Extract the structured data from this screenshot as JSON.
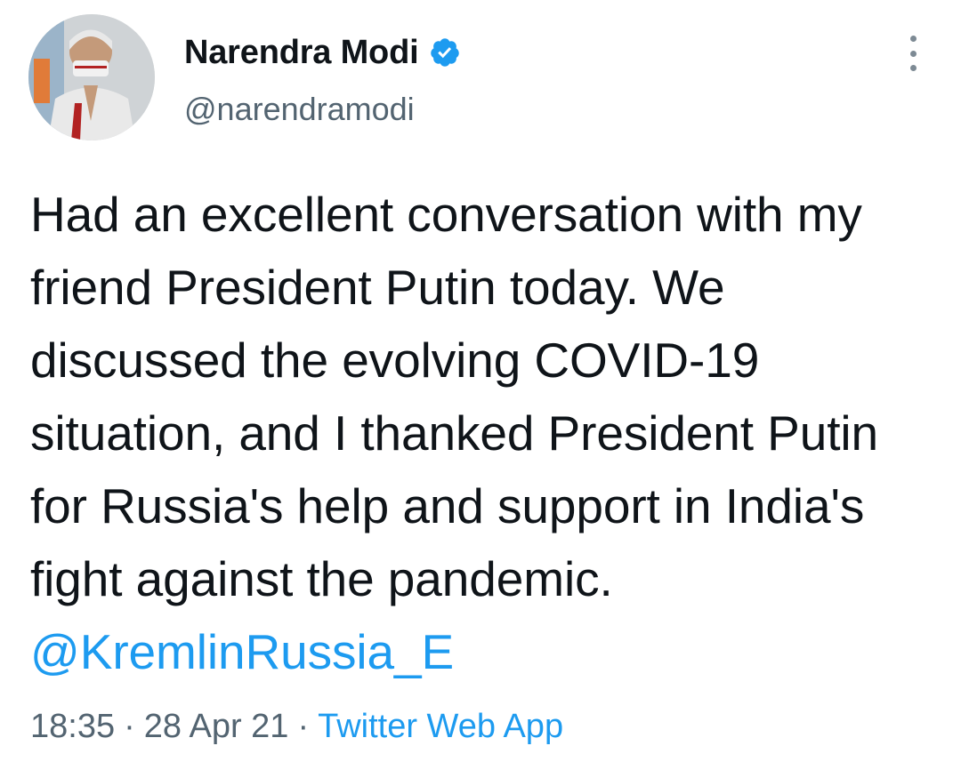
{
  "user": {
    "display_name": "Narendra Modi",
    "handle": "@narendramodi",
    "verified_icon": "verified-badge-icon",
    "verified_color": "#1d9bf0"
  },
  "tweet": {
    "text": "Had an excellent conversation with my friend President Putin today. We discussed the evolving COVID-19 situation, and I thanked President Putin for Russia's help and support in India's fight against the pandemic. ",
    "mention": "@KremlinRussia_E",
    "time": "18:35",
    "separator": "·",
    "date": "28 Apr 21",
    "source": "Twitter Web App"
  },
  "actions": {
    "more_icon": "more-options-icon"
  },
  "colors": {
    "text": "#0f1419",
    "secondary": "#536471",
    "link": "#1d9bf0"
  }
}
